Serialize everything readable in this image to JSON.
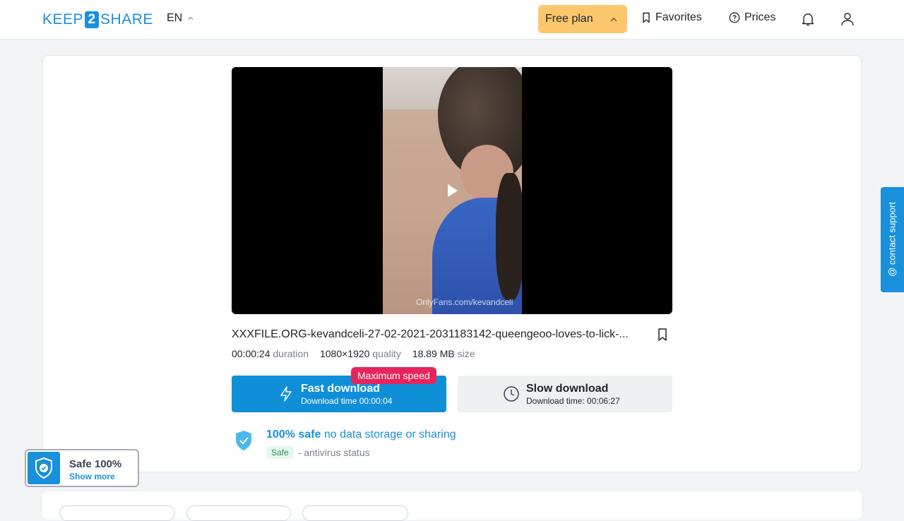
{
  "header": {
    "logo_left": "KEEP",
    "logo_mid": "2",
    "logo_right": "SHARE",
    "language": "EN",
    "plan_label": "Free plan",
    "favorites_label": "Favorites",
    "prices_label": "Prices"
  },
  "video": {
    "watermark": "OnlyFans.com/kevandceli"
  },
  "file": {
    "name": "XXXFILE.ORG-kevandceli-27-02-2021-2031183142-queengeoo-loves-to-lick-...",
    "duration_value": "00:00:24",
    "duration_label": "duration",
    "quality_value": "1080×1920",
    "quality_label": "quality",
    "size_value": "18.89 MB",
    "size_label": "size"
  },
  "download": {
    "fast_title": "Fast download",
    "fast_sub": "Download time 00:00:04",
    "max_speed_badge": "Maximum speed",
    "slow_title": "Slow download",
    "slow_sub": "Download time: 00:06:27"
  },
  "safety": {
    "bold": "100% safe",
    "note": "no data storage or sharing",
    "status_badge": "Safe",
    "status_text": "- antivirus status"
  },
  "support": {
    "label": "@ contact support"
  },
  "widget": {
    "title": "Safe 100%",
    "link": "Show more"
  },
  "colors": {
    "brand_blue": "#1a8fdc",
    "plan_yellow": "#fcc66d",
    "badge_pink": "#e8245c"
  }
}
